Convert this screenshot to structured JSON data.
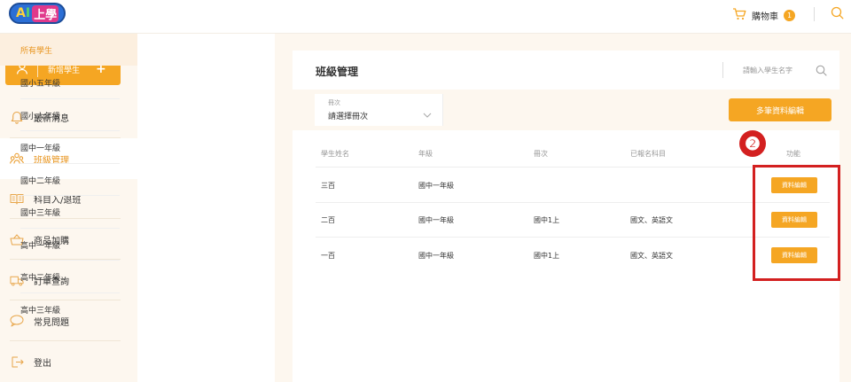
{
  "header": {
    "logo_text": "AI上學",
    "cart_label": "購物車",
    "cart_count": "1"
  },
  "sidebar": {
    "add_student_label": "新增學生",
    "add_plus": "+",
    "items": [
      {
        "label": "最新消息",
        "icon": "bell-icon"
      },
      {
        "label": "班級管理",
        "icon": "group-icon",
        "active": true
      },
      {
        "label": "科目入/退班",
        "icon": "book-icon"
      },
      {
        "label": "商品加購",
        "icon": "basket-icon"
      },
      {
        "label": "訂單查詢",
        "icon": "truck-icon"
      },
      {
        "label": "常見問題",
        "icon": "chat-bubble-icon"
      },
      {
        "label": "登出",
        "icon": "logout-icon"
      }
    ]
  },
  "grades": {
    "items": [
      "所有學生",
      "國小五年級",
      "國小六年級",
      "國中一年級",
      "國中二年級",
      "國中三年級",
      "高中一年級",
      "高中二年級",
      "高中三年級"
    ],
    "active_index": 0
  },
  "main": {
    "title": "班級管理",
    "search_placeholder": "請輸入學生名字",
    "term_caption": "冊次",
    "term_value": "請選擇冊次",
    "multi_edit_label": "多筆資料編輯",
    "columns": [
      "學生姓名",
      "年級",
      "冊次",
      "已報名科目",
      "功能"
    ],
    "rows": [
      {
        "name": "三百",
        "grade": "國中一年級",
        "term": "",
        "subjects": "",
        "action": "資料編輯"
      },
      {
        "name": "二百",
        "grade": "國中一年級",
        "term": "國中1上",
        "subjects": "國文、英語文",
        "action": "資料編輯"
      },
      {
        "name": "一百",
        "grade": "國中一年級",
        "term": "國中1上",
        "subjects": "國文、英語文",
        "action": "資料編輯"
      }
    ]
  },
  "annotation": {
    "marker": "❷",
    "color": "#d32020"
  },
  "colors": {
    "accent": "#f5a623",
    "accent_text": "#e8951f",
    "sidebar_bg": "#fdf7ef"
  }
}
